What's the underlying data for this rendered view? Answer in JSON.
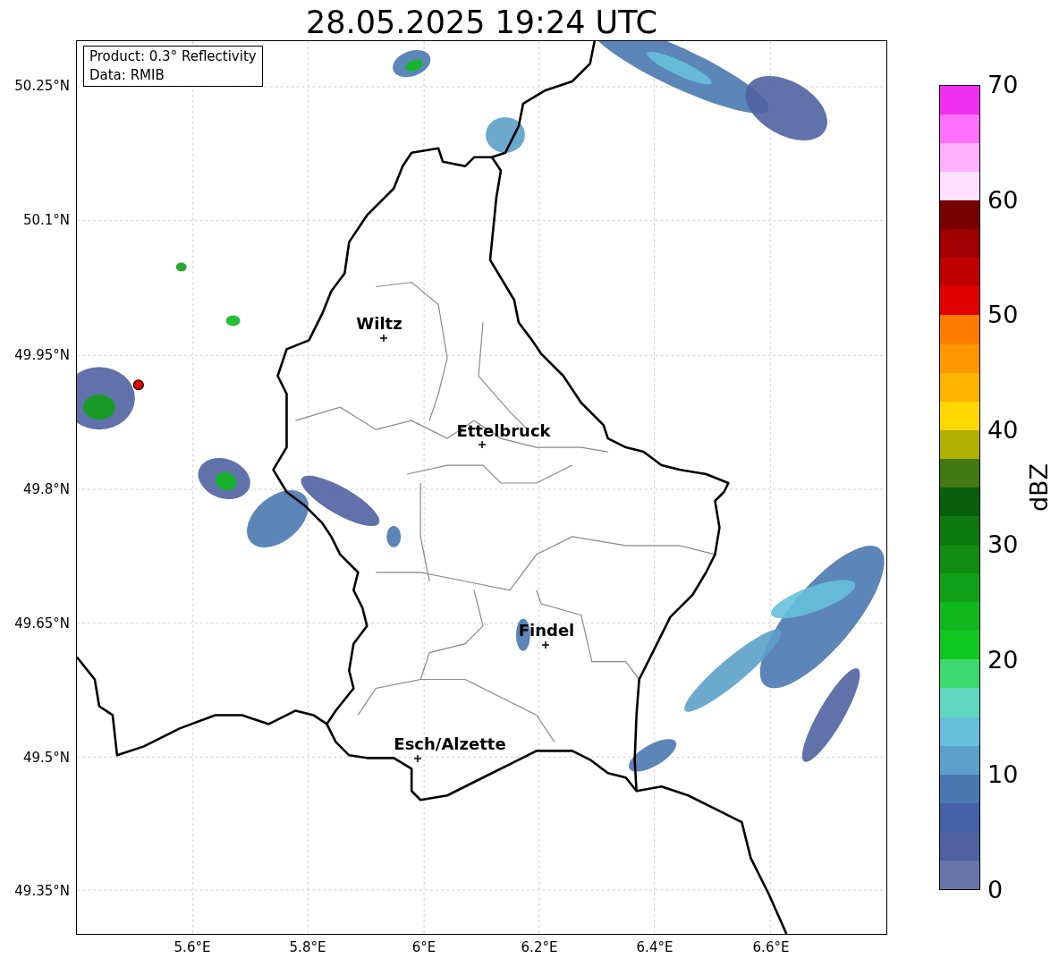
{
  "title": "28.05.2025 19:24 UTC",
  "info_box": {
    "lines": [
      "Product: 0.3° Reflectivity",
      "Data: RMIB"
    ]
  },
  "map": {
    "lat_labels": [
      "50.25°N",
      "50.1°N",
      "49.95°N",
      "49.8°N",
      "49.65°N",
      "49.5°N",
      "49.35°N"
    ],
    "lon_labels": [
      "5.6°E",
      "5.8°E",
      "6°E",
      "6.2°E",
      "6.4°E",
      "6.6°E"
    ],
    "cities": [
      {
        "name": "Wiltz"
      },
      {
        "name": "Ettelbruck"
      },
      {
        "name": "Findel"
      },
      {
        "name": "Esch/Alzette"
      }
    ]
  },
  "colorbar": {
    "label": "dBZ",
    "ticks": [
      "70",
      "60",
      "50",
      "40",
      "30",
      "20",
      "10",
      "0"
    ],
    "segments": [
      {
        "color": "#6674a8"
      },
      {
        "color": "#5062a0"
      },
      {
        "color": "#4460a8"
      },
      {
        "color": "#4a78b0"
      },
      {
        "color": "#5ba0c8"
      },
      {
        "color": "#66c0dc"
      },
      {
        "color": "#60d8c0"
      },
      {
        "color": "#3cd870"
      },
      {
        "color": "#10c820"
      },
      {
        "color": "#10b820"
      },
      {
        "color": "#10a018"
      },
      {
        "color": "#108c10"
      },
      {
        "color": "#0c7810"
      },
      {
        "color": "#0a600a"
      },
      {
        "color": "#447810"
      },
      {
        "color": "#b0b000"
      },
      {
        "color": "#ffd800"
      },
      {
        "color": "#ffb400"
      },
      {
        "color": "#ff9800"
      },
      {
        "color": "#ff7c00"
      },
      {
        "color": "#e00000"
      },
      {
        "color": "#c00000"
      },
      {
        "color": "#a00000"
      },
      {
        "color": "#780000"
      },
      {
        "color": "#ffe0ff"
      },
      {
        "color": "#ffb0ff"
      },
      {
        "color": "#ff70ff"
      },
      {
        "color": "#f030f0"
      }
    ]
  }
}
